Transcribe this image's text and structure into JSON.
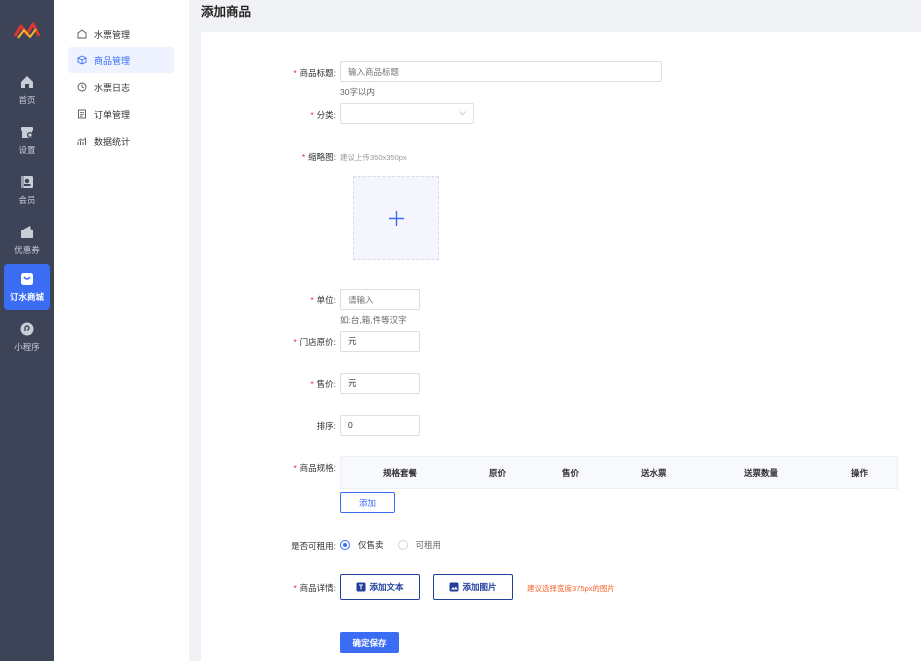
{
  "rail": {
    "items": [
      {
        "label": "首页",
        "icon": "home-icon"
      },
      {
        "label": "设置",
        "icon": "store-settings-icon"
      },
      {
        "label": "会员",
        "icon": "member-card-icon"
      },
      {
        "label": "优惠券",
        "icon": "coupon-icon"
      },
      {
        "label": "订水商城",
        "icon": "shopping-bag-icon"
      },
      {
        "label": "小程序",
        "icon": "mini-program-icon"
      }
    ]
  },
  "submenu": {
    "items": [
      {
        "label": "水票管理",
        "icon": "ticket-icon"
      },
      {
        "label": "商品管理",
        "icon": "cube-icon"
      },
      {
        "label": "水票日志",
        "icon": "clock-icon"
      },
      {
        "label": "订单管理",
        "icon": "order-list-icon"
      },
      {
        "label": "数据统计",
        "icon": "stats-icon"
      }
    ]
  },
  "page": {
    "title": "添加商品"
  },
  "form": {
    "title": {
      "label": "商品标题:",
      "placeholder": "输入商品标题",
      "hint": "30字以内"
    },
    "category": {
      "label": "分类:",
      "value": ""
    },
    "thumb": {
      "label": "缩略图:",
      "hint": "建议上传350x350px"
    },
    "unit": {
      "label": "单位:",
      "placeholder": "请输入",
      "hint": "如:台,箱,件等汉字"
    },
    "orig_price": {
      "label": "门店原价:",
      "value": "元"
    },
    "price": {
      "label": "售价:",
      "value": "元"
    },
    "sort": {
      "label": "排序:",
      "value": "0"
    },
    "spec": {
      "label": "商品规格:",
      "columns": [
        "规格套餐",
        "原价",
        "售价",
        "送水票",
        "送票数量",
        "操作"
      ],
      "add_label": "添加"
    },
    "rent": {
      "label": "是否可租用:",
      "options": [
        "仅售卖",
        "可租用"
      ],
      "selected": "仅售卖"
    },
    "detail": {
      "label": "商品详情:",
      "add_text": "添加文本",
      "add_image": "添加图片",
      "hint": "建议选择宽度375px的图片"
    },
    "save_label": "确定保存"
  },
  "colors": {
    "rail_bg": "#3d4458",
    "accent": "#3a6cf4",
    "required": "#f5222d",
    "warning_text": "#f5622d"
  }
}
